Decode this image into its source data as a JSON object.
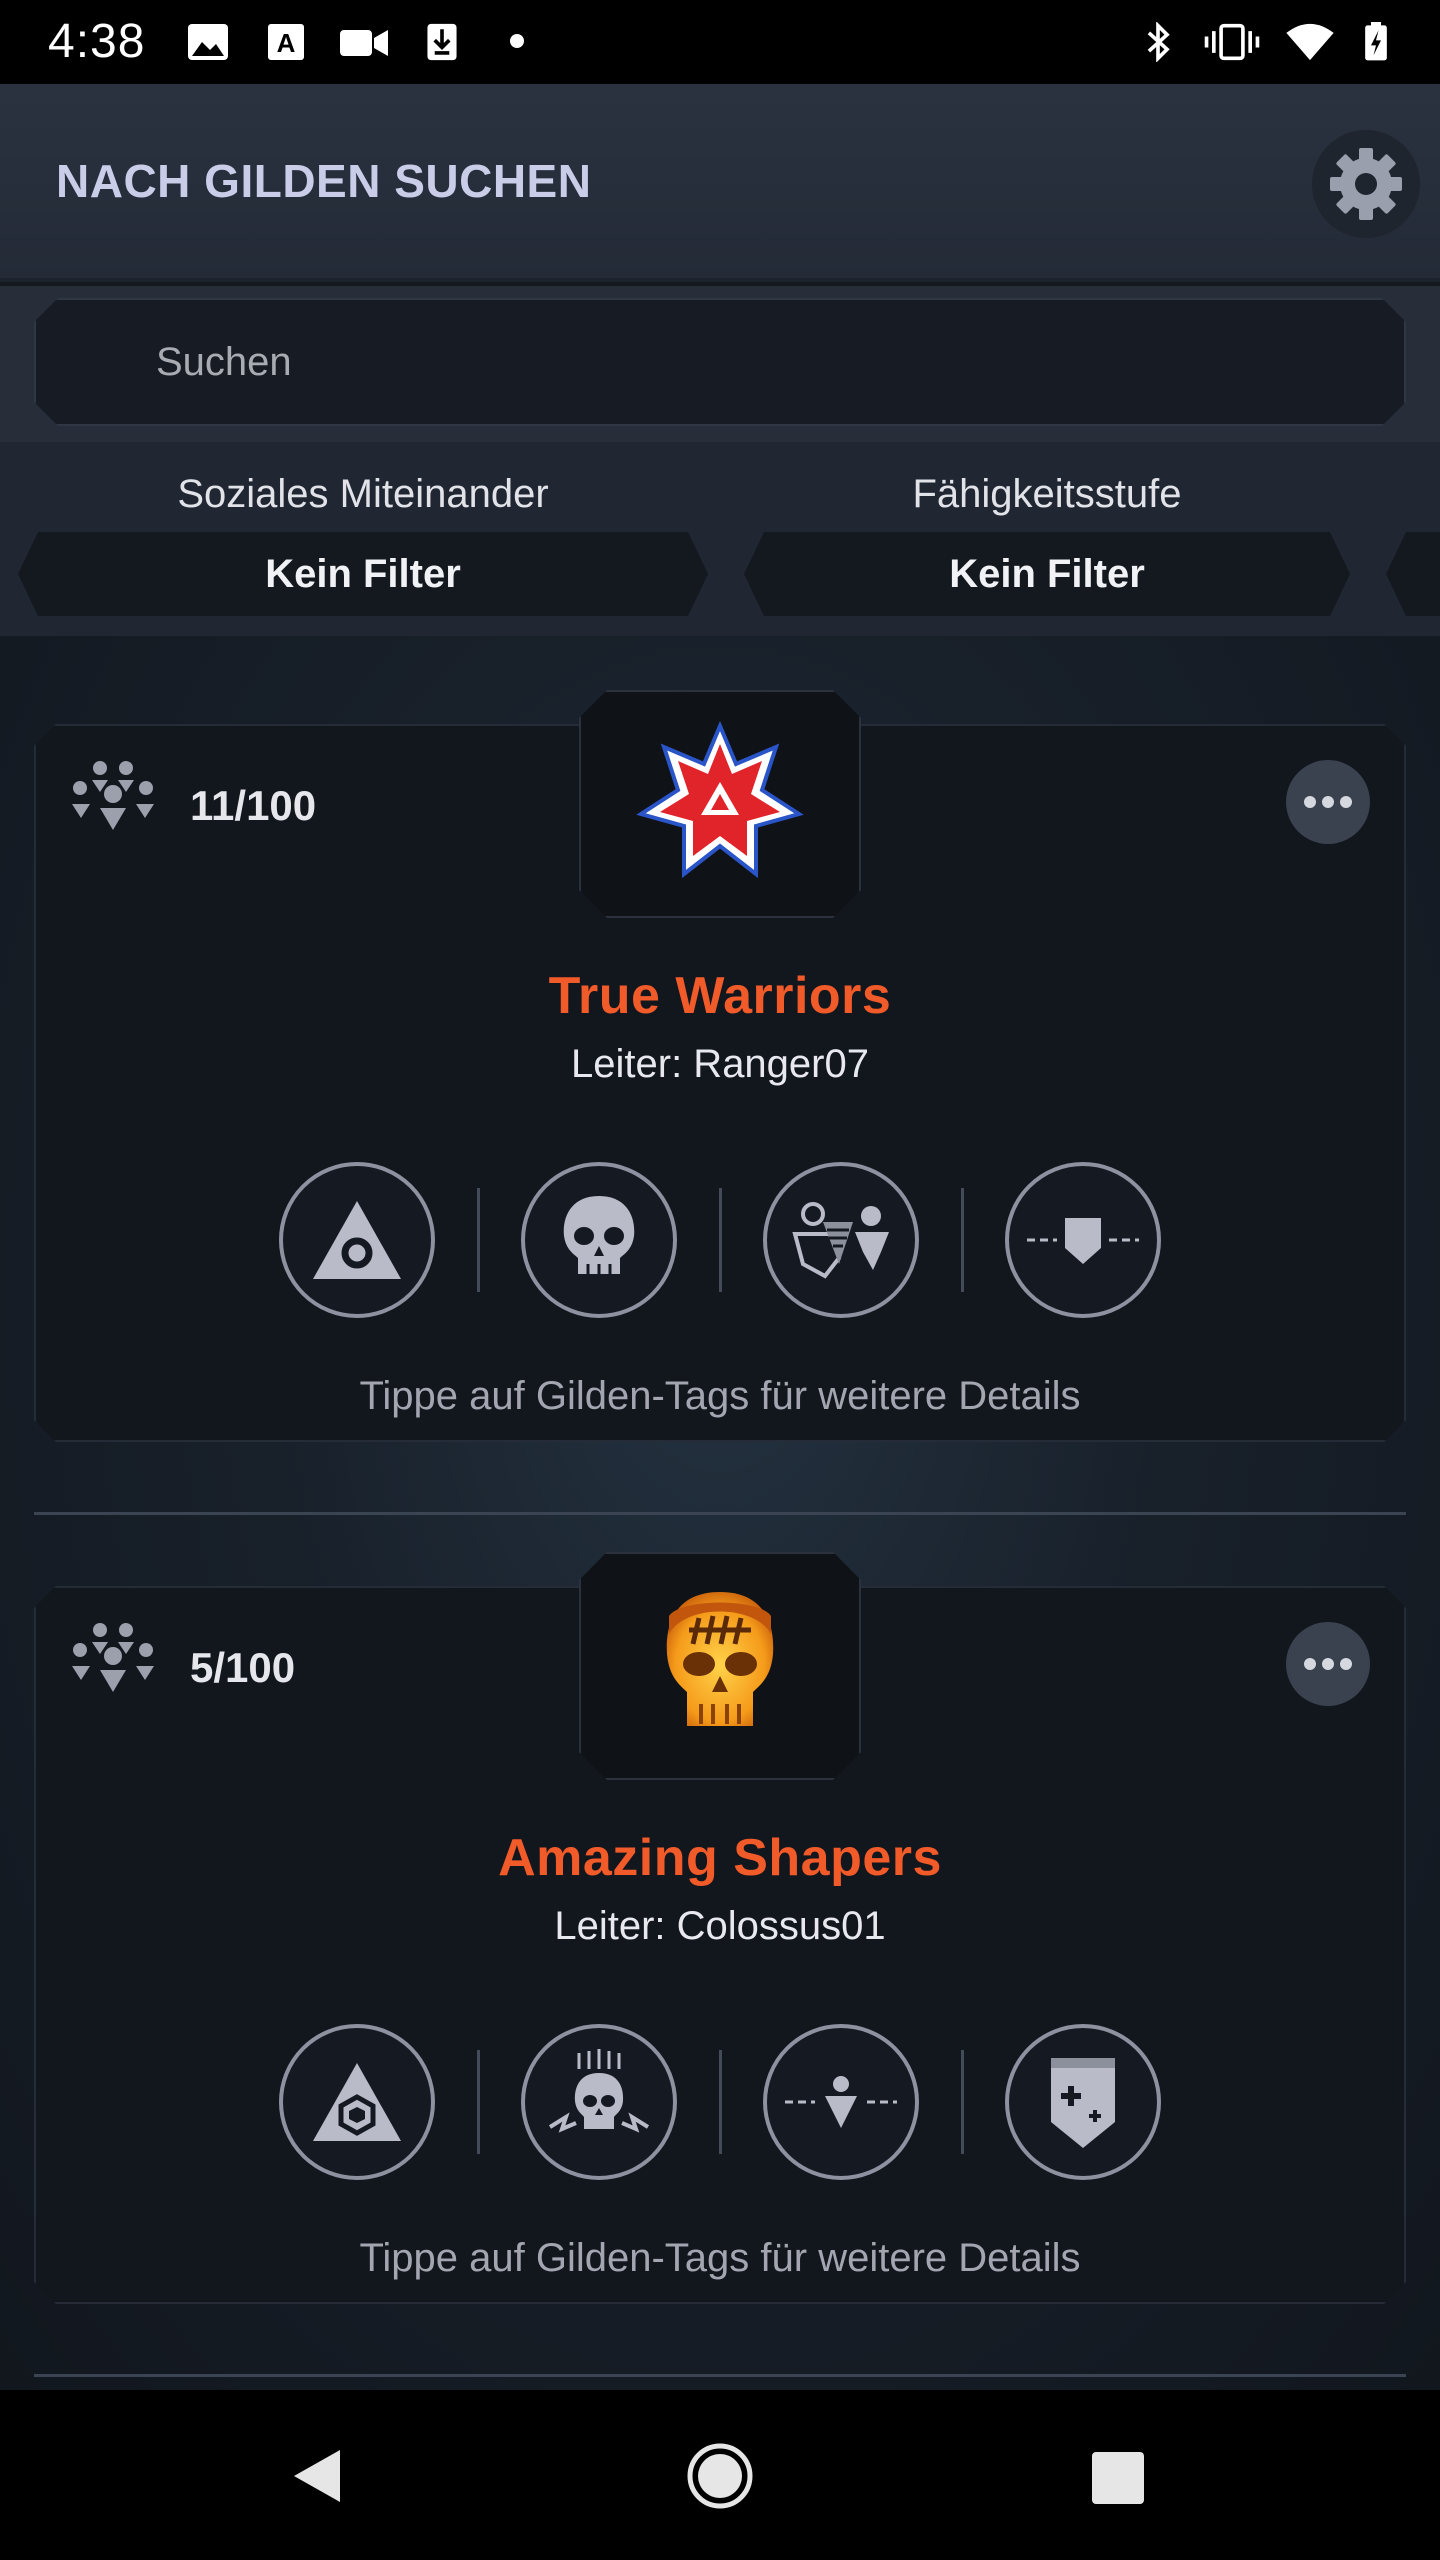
{
  "status_bar": {
    "time": "4:38",
    "left_icons": [
      "image-icon",
      "font-icon",
      "video-icon",
      "download-icon"
    ],
    "right_icons": [
      "bluetooth-icon",
      "vibrate-icon",
      "wifi-icon",
      "battery-icon"
    ]
  },
  "header": {
    "title": "NACH GILDEN SUCHEN",
    "settings_icon": "gear-icon"
  },
  "search": {
    "placeholder": "Suchen"
  },
  "filters": [
    {
      "label": "Soziales Miteinander",
      "value": "Kein Filter"
    },
    {
      "label": "Fähigkeitsstufe",
      "value": "Kein Filter"
    }
  ],
  "guilds": [
    {
      "members": "11/100",
      "name": "True Warriors",
      "leader": "Leiter: Ranger07",
      "emblem": "red-star-emblem",
      "tags": [
        "triangle-tag-icon",
        "skull-tag-icon",
        "social-group-tag-icon",
        "shield-dash-tag-icon"
      ],
      "hint": "Tippe auf Gilden-Tags für weitere Details"
    },
    {
      "members": "5/100",
      "name": "Amazing Shapers",
      "leader": "Leiter: Colossus01",
      "emblem": "orange-skull-emblem",
      "tags": [
        "hexagon-triangle-tag-icon",
        "skull-lightning-tag-icon",
        "person-dash-tag-icon",
        "shield-plus-tag-icon"
      ],
      "hint": "Tippe auf Gilden-Tags für weitere Details"
    }
  ],
  "nav_bar": {
    "icons": [
      "back-icon",
      "home-icon",
      "recents-icon"
    ]
  }
}
